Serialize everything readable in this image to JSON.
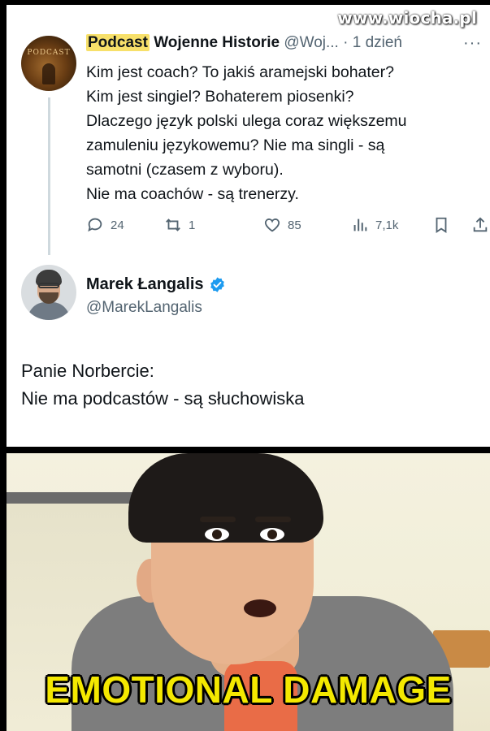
{
  "watermark": "www.wiocha.pl",
  "tweet1": {
    "avatar_text": "PODCAST",
    "name_highlight": "Podcast",
    "name_rest": "Wojenne Historie",
    "handle": "@Woj...",
    "time": "· 1 dzień",
    "more": "···",
    "lines": [
      "Kim jest coach? To jakiś aramejski bohater?",
      "Kim jest singiel? Bohaterem piosenki?",
      "Dlaczego język polski ulega coraz większemu",
      "zamuleniu językowemu? Nie ma singli - są",
      "samotni (czasem z wyboru).",
      "Nie ma coachów - są trenerzy."
    ],
    "actions": {
      "replies": "24",
      "retweets": "1",
      "likes": "85",
      "views": "7,1k"
    },
    "icons": [
      "reply-icon",
      "retweet-icon",
      "like-icon",
      "views-icon",
      "bookmark-icon",
      "share-icon"
    ]
  },
  "tweet2": {
    "name": "Marek Łangalis",
    "handle": "@MarekLangalis",
    "lines": [
      "Panie Norbercie:",
      "Nie ma podcastów - są słuchowiska"
    ],
    "verified_color": "#1d9bf0"
  },
  "meme": {
    "caption": "EMOTIONAL DAMAGE",
    "caption_color": "#f4e800"
  }
}
